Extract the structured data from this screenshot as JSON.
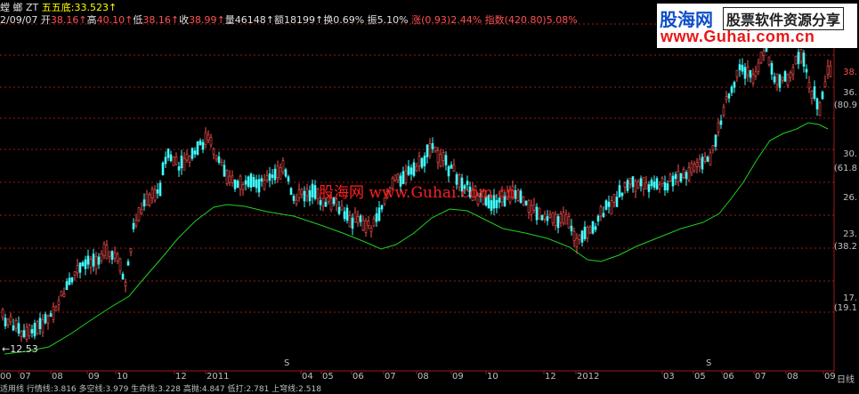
{
  "header": {
    "title": "螳 螂 ZT",
    "indicator_label": "五五底:",
    "indicator_value": "33.523",
    "indicator_arrow": "↑",
    "date": "2/09/07",
    "open_label": "开",
    "open": "38.16",
    "high_label": "高",
    "high": "40.10",
    "low_label": "低",
    "low": "38.16",
    "close_label": "收",
    "close": "38.99",
    "volume_label": "量",
    "volume": "46148",
    "amount_label": "额",
    "amount": "18199",
    "turnover_label": "换",
    "turnover": "0.69%",
    "amplitude_label": "振",
    "amplitude": "5.10%",
    "change_label": "涨",
    "change": "(0.93)2.44%",
    "index_label": "指数",
    "index": "(420.80)5.08%",
    "up_arrow": "↑"
  },
  "logo": {
    "name": "股海网",
    "tagline": "股票软件资源分享",
    "url": "www.Guhai.com.cn"
  },
  "watermark": "股海网 www.Guhai.com.cn",
  "price_labels": [
    {
      "text": "38.",
      "color": "#ff5050"
    },
    {
      "text": "36.",
      "color": "#c0c0c0"
    },
    {
      "text": "(80.9",
      "color": "#c0c0c0"
    },
    {
      "text": "30.",
      "color": "#c0c0c0"
    },
    {
      "text": "(61.8",
      "color": "#c0c0c0"
    },
    {
      "text": "26.",
      "color": "#c0c0c0"
    },
    {
      "text": "23.",
      "color": "#c0c0c0"
    },
    {
      "text": "(38.2",
      "color": "#c0c0c0"
    },
    {
      "text": "17.",
      "color": "#c0c0c0"
    },
    {
      "text": "(19.1",
      "color": "#c0c0c0"
    }
  ],
  "low_marker": "←12.53",
  "x_axis": [
    "00",
    "07",
    "08",
    "09",
    "10",
    "12",
    "2011",
    "04",
    "05",
    "06",
    "07",
    "08",
    "09",
    "10",
    "12",
    "2012",
    "03",
    "05",
    "06",
    "07",
    "08",
    "09"
  ],
  "axis_end_label": "日线",
  "s_marker": "S",
  "bottom_text": "适用线 行情线:3.816 多空线:3.979 生命线:3.228 高抛:4.847 低打:2.781 上穹线:2.518",
  "colors": {
    "up": "#ff5050",
    "down": "#40ffff",
    "ma": "#20d020",
    "grid": "#a01818",
    "background": "#000000"
  },
  "chart_data": {
    "type": "candlestick",
    "price_scale": [
      12.53,
      40.1
    ],
    "lines": [
      {
        "name": "生命线"
      }
    ]
  }
}
